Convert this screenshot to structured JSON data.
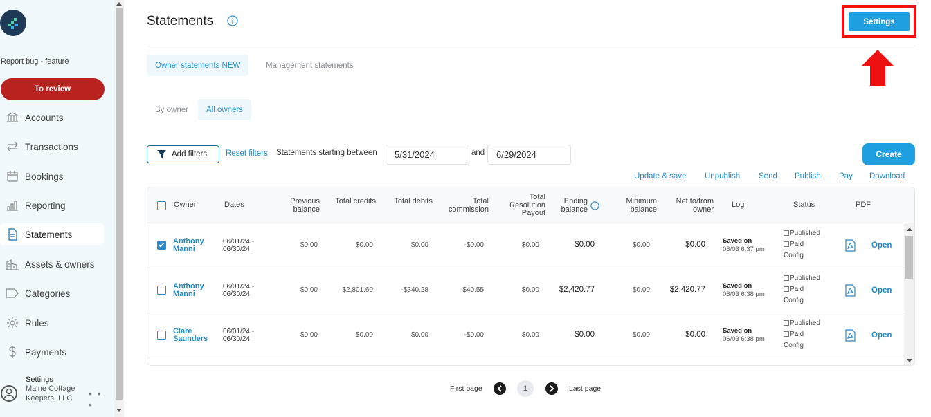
{
  "sidebar": {
    "report_bug": "Report bug - feature",
    "to_review": "To review",
    "items": [
      {
        "label": "Accounts",
        "icon": "bank-icon"
      },
      {
        "label": "Transactions",
        "icon": "transfer-arrows-icon"
      },
      {
        "label": "Bookings",
        "icon": "calendar-icon"
      },
      {
        "label": "Reporting",
        "icon": "bar-chart-icon"
      },
      {
        "label": "Statements",
        "icon": "document-icon",
        "active": true
      },
      {
        "label": "Assets & owners",
        "icon": "buildings-icon"
      },
      {
        "label": "Categories",
        "icon": "tag-icon"
      },
      {
        "label": "Rules",
        "icon": "gear-icon"
      },
      {
        "label": "Payments",
        "icon": "dollar-icon"
      }
    ],
    "user": {
      "title": "Settings",
      "org": "Maine Cottage Keepers, LLC",
      "more": "• • •"
    }
  },
  "header": {
    "title": "Statements",
    "settings_label": "Settings"
  },
  "tabs": {
    "owner_statements": "Owner statements NEW",
    "management_statements": "Management statements"
  },
  "subtabs": {
    "by_owner": "By owner",
    "all_owners": "All owners"
  },
  "filters": {
    "add_filters": "Add filters",
    "reset_filters": "Reset filters",
    "between_label": "Statements starting between",
    "start_date": "5/31/2024",
    "and_label": "and",
    "end_date": "6/29/2024"
  },
  "create_label": "Create",
  "actions": [
    "Update & save",
    "Unpublish",
    "Send",
    "Publish",
    "Pay",
    "Download"
  ],
  "table": {
    "headers": {
      "owner": "Owner",
      "dates": "Dates",
      "previous_balance": "Previous balance",
      "total_credits": "Total credits",
      "total_debits": "Total debits",
      "total_commission": "Total commission",
      "total_resolution_payout": "Total Resolution Payout",
      "ending_balance": "Ending balance",
      "minimum_balance": "Minimum balance",
      "net_to_from_owner": "Net to/from owner",
      "log": "Log",
      "status": "Status",
      "pdf": "PDF"
    },
    "rows": [
      {
        "owner": "Anthony Manni",
        "dates": "06/01/24 - 06/30/24",
        "previous_balance": "$0.00",
        "total_credits": "$0.00",
        "total_debits": "$0.00",
        "total_commission": "-$0.00",
        "total_resolution_payout": "$0.00",
        "ending_balance": "$0.00",
        "minimum_balance": "$0.00",
        "net": "$0.00",
        "log_title": "Saved on",
        "log_time": "06/03 6:37 pm",
        "status_published": "Published",
        "status_paid": "Paid",
        "status_config": "Config",
        "open": "Open",
        "checked": true
      },
      {
        "owner": "Anthony Manni",
        "dates": "06/01/24 - 06/30/24",
        "previous_balance": "$0.00",
        "total_credits": "$2,801.60",
        "total_debits": "-$340.28",
        "total_commission": "-$40.55",
        "total_resolution_payout": "$0.00",
        "ending_balance": "$2,420.77",
        "minimum_balance": "$0.00",
        "net": "$2,420.77",
        "log_title": "Saved on",
        "log_time": "06/03 6:38 pm",
        "status_published": "Published",
        "status_paid": "Paid",
        "status_config": "Config",
        "open": "Open",
        "checked": false
      },
      {
        "owner": "Clare Saunders",
        "dates": "06/01/24 - 06/30/24",
        "previous_balance": "$0.00",
        "total_credits": "$0.00",
        "total_debits": "$0.00",
        "total_commission": "-$0.00",
        "total_resolution_payout": "$0.00",
        "ending_balance": "$0.00",
        "minimum_balance": "$0.00",
        "net": "$0.00",
        "log_title": "Saved on",
        "log_time": "06/03 6:38 pm",
        "status_published": "Published",
        "status_paid": "Paid",
        "status_config": "Config",
        "open": "Open",
        "checked": false
      }
    ]
  },
  "pagination": {
    "first": "First page",
    "current": "1",
    "last": "Last page"
  },
  "colors": {
    "accent": "#1f9ee0",
    "to_review": "#b8231f",
    "highlight": "#ee1111"
  }
}
